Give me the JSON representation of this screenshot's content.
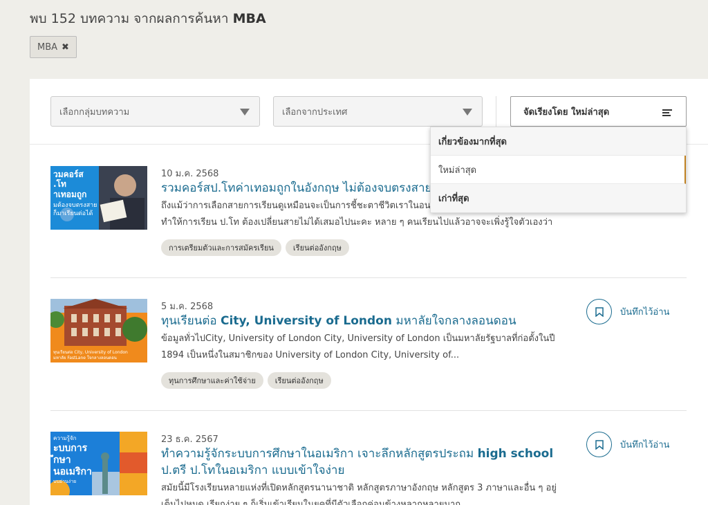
{
  "header": {
    "prefix": "พบ",
    "count": "152",
    "middle": "บทความ จากผลการค้นหา",
    "query": "MBA"
  },
  "active_filter": {
    "label": "MBA"
  },
  "filters": {
    "category_placeholder": "เลือกกลุ่มบทความ",
    "country_placeholder": "เลือกจากประเทศ",
    "sort_label": "จัดเรียงโดย ใหม่ล่าสุด"
  },
  "sort_options": [
    "เกี่ยวข้องมากที่สุด",
    "ใหม่ล่าสุด",
    "เก่าที่สุด"
  ],
  "save_label": "บันทึกไว้อ่าน",
  "articles": [
    {
      "date": "10 ม.ค. 2568",
      "title": "รวมคอร์สป.โทค่าเทอมถูกในอังกฤษ ไม่ต้องจบตรงสาย",
      "excerpt": "ถึงแม้ว่าการเลือกสายการเรียนดูเหมือนจะเป็นการชี้ชะตาชีวิตเราในอนาคต แต่การเลือกสายการเรียนไม่ได้ทำให้การเรียน ป.โท ต้องเปลี่ยนสายไม่ได้เสมอไปนะคะ หลาย ๆ คนเรียนไปแล้วอาจจะเพิ่งรู้ใจตัวเองว่าอยากเปลี่ยนสาขาที่เรียน...",
      "tags": [
        "การเตรียมตัวและการสมัครเรียน",
        "เรียนต่ออังกฤษ"
      ],
      "thumb_text": [
        "วมคอร์ส",
        ".โท",
        "าเทอมถูก",
        "มต้องจบตรงสาย",
        "ก็มาเรียนต่อได้"
      ]
    },
    {
      "date": "5 ม.ค. 2568",
      "title_pre": "ทุนเรียนต่อ ",
      "title_bold": "City, University of London",
      "title_post": " มหาลัยใจกลางลอนดอน",
      "excerpt": "ข้อมูลทั่วไปCity, University of London City, University of London เป็นมหาลัยรัฐบาลที่ก่อตั้งในปี 1894 เป็นหนึ่งในสมาชิกของ University of London       City, University of...",
      "tags": [
        "ทุนการศึกษาและค่าใช้จ่าย",
        "เรียนต่ออังกฤษ"
      ],
      "thumb_text": [
        "ทุนเรียนต่อ City, University of London",
        "มหาลัย FastLane ใจกลางลอนดอน"
      ]
    },
    {
      "date": "23 ธ.ค. 2567",
      "title_pre": "ทำความรู้จักระบบการศึกษาในอเมริกา เจาะลึกหลักสูตรประถม ",
      "title_bold": "high school",
      "title_post": " ป.ตรี ป.โทในอเมริกา แบบเข้าใจง่าย",
      "excerpt": "สมัยนี้มีโรงเรียนหลายแห่งที่เปิดหลักสูตรนานาชาติ หลักสูตรภาษาอังกฤษ หลักสูตร 3 ภาษาและอื่น ๆ อยู่เต็มไปหมด เรียกง่าย ๆ ก็เริ่มเข้าเรียนในยุคที่มีตัวเลือกค่อนข้างหลากหลายมาก...",
      "tags": [],
      "thumb_text": [
        "ความรู้จัก",
        "ะบบการ",
        "ึกษา",
        "นอเมริกา",
        "บบอ่านง่าย"
      ]
    }
  ],
  "colors": {
    "accent": "#1a6b8f",
    "page_bg": "#efeee9",
    "tag_bg": "#e4e2dc"
  }
}
